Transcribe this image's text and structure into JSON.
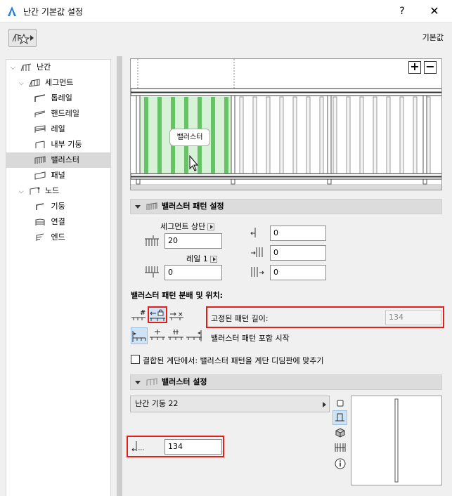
{
  "window": {
    "title": "난간 기본값 설정",
    "help": "?",
    "close": "✕"
  },
  "toolbar": {
    "default_label": "기본값"
  },
  "tree": {
    "items": [
      {
        "label": "난간"
      },
      {
        "label": "세그먼트"
      },
      {
        "label": "톱레일"
      },
      {
        "label": "핸드레일"
      },
      {
        "label": "레일"
      },
      {
        "label": "내부 기둥"
      },
      {
        "label": "밸러스터"
      },
      {
        "label": "패널"
      },
      {
        "label": "노드"
      },
      {
        "label": "기둥"
      },
      {
        "label": "연결"
      },
      {
        "label": "엔드"
      }
    ]
  },
  "preview": {
    "tooltip": "밸러스터",
    "zoom_in": "+",
    "zoom_out": "−"
  },
  "pattern_settings": {
    "header": "밸러스터 패턴 설정",
    "segment_top_label": "세그먼트 상단",
    "segment_top_value": "20",
    "rail_label": "레일 1",
    "rail_value": "0",
    "right_values": [
      "0",
      "0",
      "0"
    ]
  },
  "distribution": {
    "title": "밸러스터 패턴 분배 및 위치:",
    "fixed_length_label": "고정된 패턴 길이:",
    "fixed_length_value": "134",
    "pattern_start_label": "밸러스터 패턴 포함 시작",
    "checkbox_label": "결합된 계단에서: 밸러스터 패턴을 계단 디딤판에 맞추기"
  },
  "baluster_settings": {
    "header": "밸러스터 설정",
    "dropdown_value": "난간 기둥 22",
    "width_value": "134"
  },
  "colors": {
    "accent_red": "#e0201b",
    "selection_blue": "#cfe3f7",
    "pattern_green": "#8fdb8f"
  }
}
